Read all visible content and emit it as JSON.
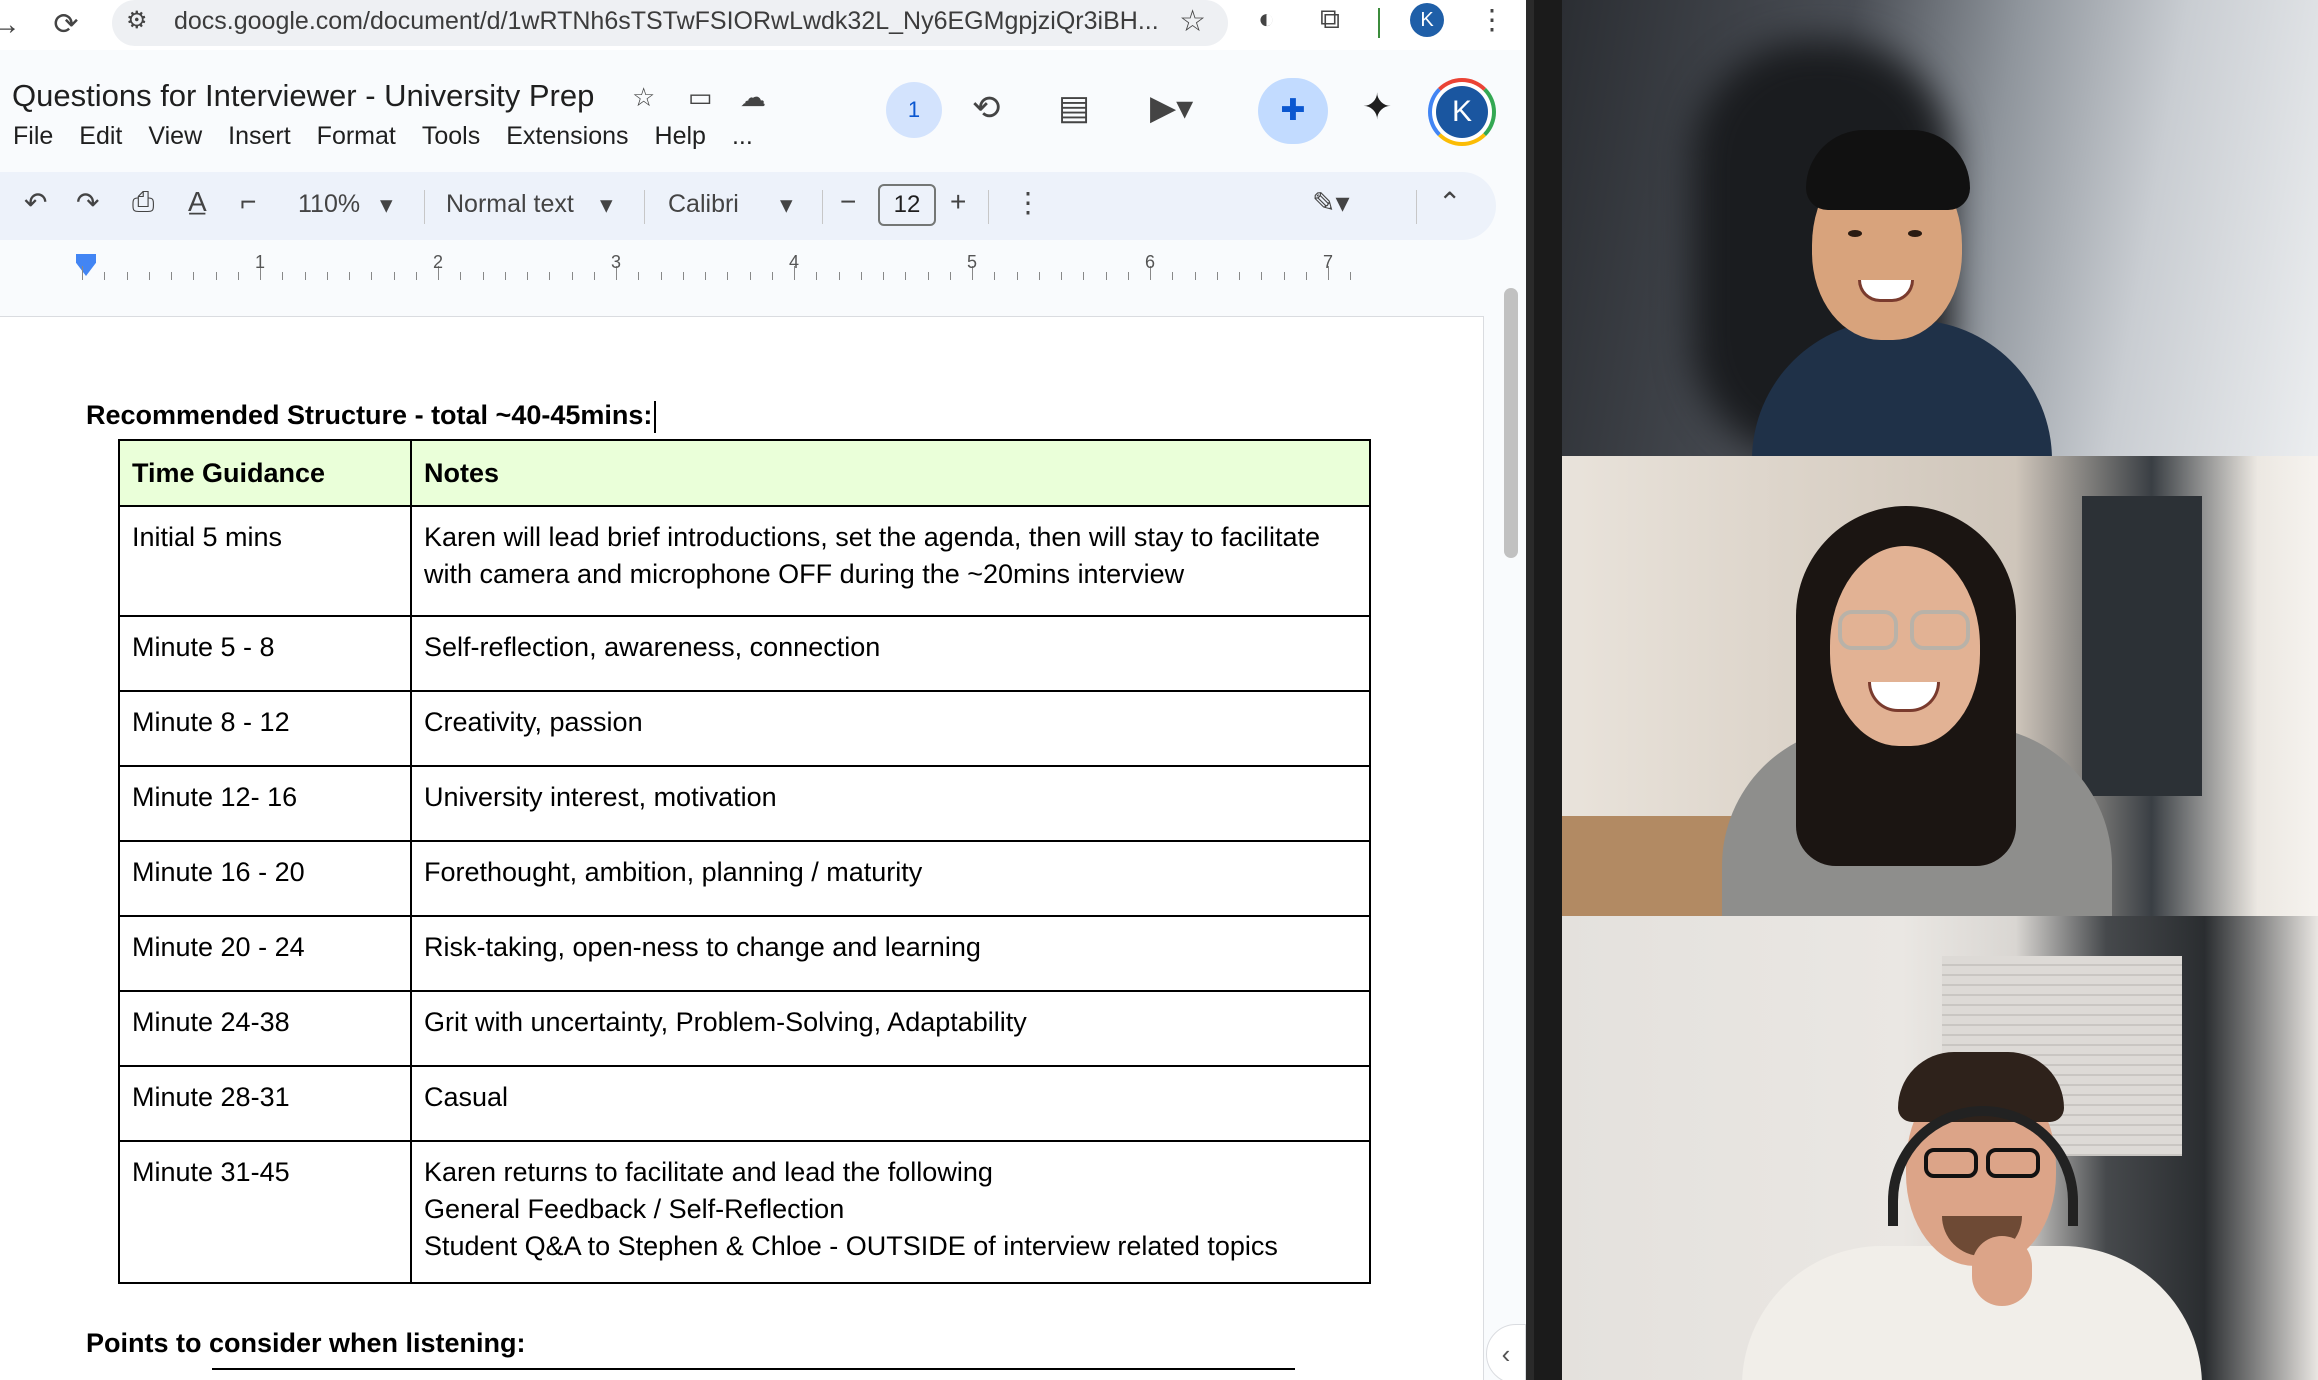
{
  "browser": {
    "url": "docs.google.com/document/d/1wRTNh6sTSTwFSIORwLwdk32L_Ny6EGMgpjziQr3iBH...",
    "profile_initial": "K"
  },
  "docs": {
    "title": "Questions for Interviewer - University Prep",
    "menu": [
      "File",
      "Edit",
      "View",
      "Insert",
      "Format",
      "Tools",
      "Extensions",
      "Help",
      "..."
    ],
    "viewers_count": "1",
    "account_initial": "K",
    "toolbar": {
      "zoom": "110%",
      "style": "Normal text",
      "font": "Calibri",
      "font_size": "12"
    },
    "ruler_numbers": [
      "1",
      "2",
      "3",
      "4",
      "5",
      "6",
      "7"
    ]
  },
  "document": {
    "heading": "Recommended Structure - total ~40-45mins:",
    "table": {
      "headers": [
        "Time Guidance",
        "Notes"
      ],
      "rows": [
        {
          "time": "Initial 5 mins",
          "notes": [
            "Karen will lead brief introductions, set the agenda, then will stay to facilitate",
            "with camera and microphone OFF during the ~20mins interview"
          ]
        },
        {
          "time": "Minute 5 - 8",
          "notes": [
            "Self-reflection, awareness, connection"
          ]
        },
        {
          "time": "Minute 8 - 12",
          "notes": [
            "Creativity, passion"
          ]
        },
        {
          "time": "Minute 12- 16",
          "notes": [
            "University interest, motivation"
          ]
        },
        {
          "time": "Minute 16 - 20",
          "notes": [
            "Forethought, ambition, planning / maturity"
          ]
        },
        {
          "time": "Minute 20 - 24",
          "notes": [
            "Risk-taking, open-ness to change and learning"
          ]
        },
        {
          "time": "Minute 24-38",
          "notes": [
            "Grit with uncertainty, Problem-Solving, Adaptability"
          ]
        },
        {
          "time": "Minute 28-31",
          "notes": [
            "Casual"
          ]
        },
        {
          "time": "Minute 31-45",
          "notes": [
            "Karen returns to facilitate and lead the following",
            "General Feedback / Self-Reflection",
            "Student Q&A to Stephen & Chloe - OUTSIDE of interview related topics"
          ]
        }
      ]
    },
    "subheading": "Points to consider when listening:"
  },
  "colors": {
    "header_fill": "#eaffd9",
    "active_speaker": "#3fc94a",
    "toolbar_bg": "#edf2fa",
    "accent_blue": "#0b57d0"
  }
}
